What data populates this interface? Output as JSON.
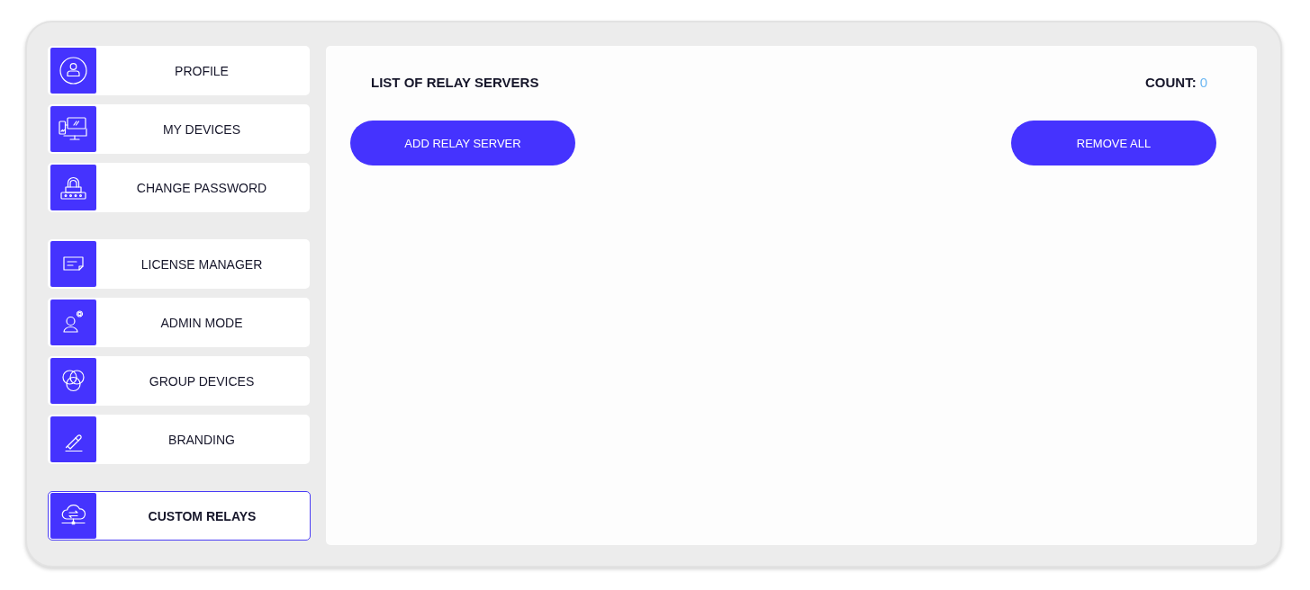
{
  "sidebar": {
    "groups": [
      {
        "items": [
          {
            "label": "PROFILE",
            "selected": false
          },
          {
            "label": "MY DEVICES",
            "selected": false
          },
          {
            "label": "CHANGE PASSWORD",
            "selected": false
          }
        ]
      },
      {
        "items": [
          {
            "label": "LICENSE MANAGER",
            "selected": false
          },
          {
            "label": "ADMIN MODE",
            "selected": false
          },
          {
            "label": "GROUP DEVICES",
            "selected": false
          },
          {
            "label": "BRANDING",
            "selected": false
          }
        ]
      },
      {
        "items": [
          {
            "label": "CUSTOM RELAYS",
            "selected": true
          }
        ]
      }
    ]
  },
  "main": {
    "title": "LIST OF RELAY SERVERS",
    "count": {
      "label": "COUNT:",
      "value": "0"
    },
    "buttons": [
      "ADD RELAY SERVER",
      "REMOVE ALL"
    ]
  }
}
